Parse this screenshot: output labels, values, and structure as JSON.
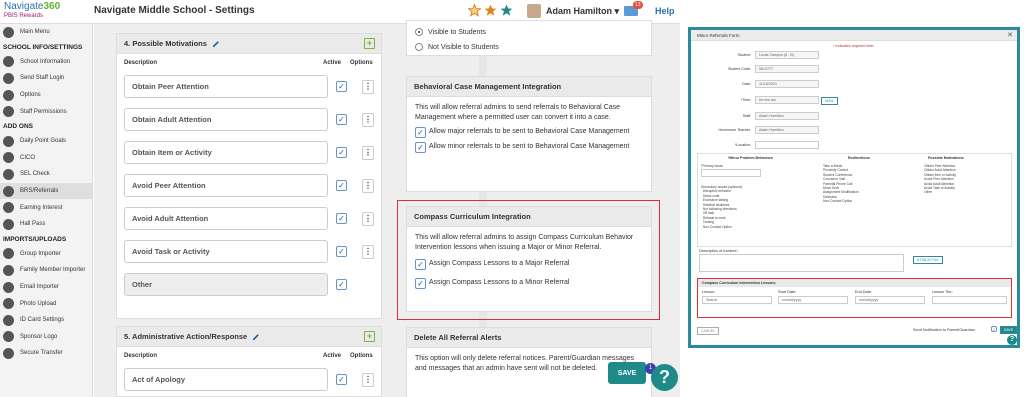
{
  "left": {
    "logo": {
      "name_a": "Navigate",
      "name_b": "360",
      "sub": "PBIS Rewards"
    },
    "title": "Navigate Middle School - Settings",
    "user": "Adam Hamilton",
    "caret": "▾",
    "mail_count": "13",
    "help": "Help",
    "sidebar": [
      {
        "label": "Main Menu",
        "icon": "back-arrow-icon"
      },
      {
        "head": "SCHOOL INFO/SETTINGS"
      },
      {
        "label": "School Information",
        "icon": "info-icon"
      },
      {
        "label": "Send Staff Login",
        "icon": "send-icon"
      },
      {
        "label": "Options",
        "icon": "checkbox-icon"
      },
      {
        "label": "Staff Permissions",
        "icon": "key-icon"
      },
      {
        "head": "ADD ONS"
      },
      {
        "label": "Daily Point Goals",
        "icon": "goal-icon"
      },
      {
        "label": "CICO",
        "icon": "heart-icon"
      },
      {
        "label": "SEL Check",
        "icon": "check-icon"
      },
      {
        "label": "BRS/Referrals",
        "icon": "alert-icon",
        "active": true
      },
      {
        "label": "Earning Interest",
        "icon": "trophy-icon"
      },
      {
        "label": "Hall Pass",
        "icon": "pass-icon"
      },
      {
        "head": "IMPORTS/UPLOADS"
      },
      {
        "label": "Group Importer",
        "icon": "group-icon"
      },
      {
        "label": "Family Member Importer",
        "icon": "family-icon"
      },
      {
        "label": "Email Importer",
        "icon": "email-icon"
      },
      {
        "label": "Photo Upload",
        "icon": "photo-icon"
      },
      {
        "label": "ID Card Settings",
        "icon": "idcard-icon"
      },
      {
        "label": "Sponsor Logo",
        "icon": "sponsor-icon"
      },
      {
        "label": "Secure Transfer",
        "icon": "lock-icon"
      }
    ],
    "motivations": {
      "title": "4. Possible Motivations",
      "col_desc": "Description",
      "col_active": "Active",
      "col_options": "Options",
      "items": [
        "Obtain Peer Attention",
        "Obtain Adult Attention",
        "Obtain Item or Activity",
        "Avoid Peer Attention",
        "Avoid Adult Attention",
        "Avoid Task or Activity",
        "Other"
      ]
    },
    "admin_action": {
      "title": "5. Administrative Action/Response",
      "col_desc": "Description",
      "col_active": "Active",
      "col_options": "Options",
      "items": [
        "Act of Apology"
      ]
    },
    "visibility": {
      "visible": "Visible to Students",
      "not_visible": "Not Visible to Students"
    },
    "bcm": {
      "title": "Behavioral Case Management Integration",
      "desc": "This will allow referral admins to send referrals to Behavioral Case Management where a permitted user can convert it into a case.",
      "opt1": "Allow major referrals to be sent to Behavioral Case Management",
      "opt2": "Allow minor referrals to be sent to Behavioral Case Management"
    },
    "compass": {
      "title": "Compass Curriculum Integration",
      "desc": "This will allow referral admins to assign Compass Curriculum Behavior Intervention lessons when issuing a Major or Minor Referral.",
      "opt1": "Assign Compass Lessons to a Major Referral",
      "opt2": "Assign Compass Lessons to a Minor Referral"
    },
    "delete_alerts": {
      "title": "Delete All Referral Alerts",
      "desc": "This option will only delete referral notices. Parent/Guardian messages and messages that an admin have sent will not be deleted."
    },
    "save": "SAVE",
    "save_badge": "1",
    "help_q": "?"
  },
  "right": {
    "title": "Minor Referrals Form",
    "required_note": "* indicates required field",
    "fields": {
      "student_lbl": "Student:",
      "student_val": "Lucas Campos (8 - B)",
      "code_lbl": "Student Code:",
      "code_val": "5813777",
      "date_lbl": "Date:",
      "date_val": "11/18/2023",
      "time_lbl": "*Time:",
      "time_val": "hh:mm am",
      "now_btn": "NOW",
      "staff_lbl": "Staff:",
      "staff_val": "Adam Hamilton",
      "homeroom_lbl": "Homeroom Teacher:",
      "homeroom_val": "Adam Hamilton",
      "location_lbl": "*Location:"
    },
    "cols": {
      "c1_title": "*Minor Problem Behaviors",
      "c1_primary": "*Primary Issue:",
      "c1_list": "Secondary Issues (optional):\n  Disruptive behavior\n  Dress code\n  Excessive talking\n  Habitual tardiness\n  Not following directions\n  Off task\n  Refusal to work\n  Tossing\n  Non Contact Option",
      "c2_title": "Redirections",
      "c2_list": "Take a Break\nProximity Control\nStudent Conference\nCounselor Visit\nParental Phone Call\nMove Seat\nAssignment Modification\nDetention\nNon-Contact Option",
      "c3_title": "Possible Motivations",
      "c3_list": "Obtain Peer Attention\nObtain Adult Attention\nObtain Item or Activity\nAvoid Peer Attention\nAvoid Adult Attention\nAvoid Task or Activity\nOther"
    },
    "incident_lbl": "Description of Incident :",
    "attach_btn": "ATTACH FILE",
    "ccil": {
      "title": "Compass Curriculum Intervention Lessons",
      "lesson_lbl": "Lesson:",
      "lesson_ph": "Search",
      "start_lbl": "Start Date:",
      "start_ph": "mm/dd/yyyy",
      "end_lbl": "End Date:",
      "end_ph": "mm/dd/yyyy",
      "tier_lbl": "Lesson Tier:"
    },
    "cancel_btn": "CANCEL",
    "notify_lbl": "Send Notification to Parent/Guardian",
    "save_btn": "SAVE",
    "help_q": "?"
  }
}
